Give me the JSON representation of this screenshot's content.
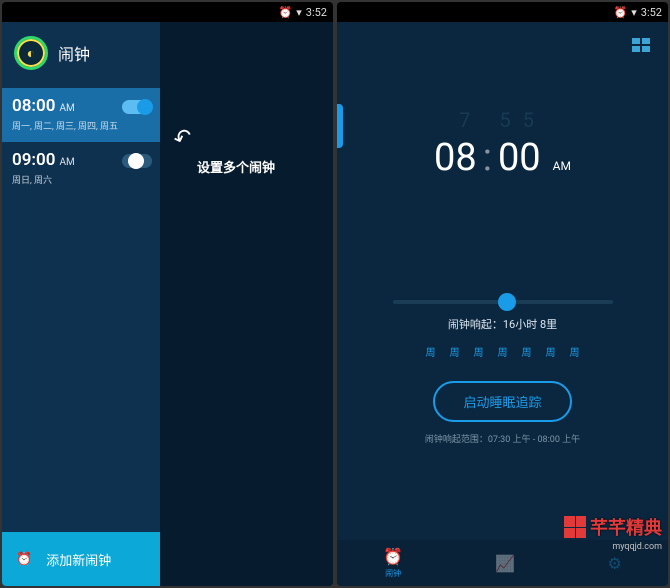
{
  "status": {
    "time": "3:52",
    "alarm_icon": "⏰",
    "wifi_icon": "▾"
  },
  "left": {
    "title": "闹钟",
    "alarms": [
      {
        "time": "08:00",
        "ampm": "AM",
        "days": "周一, 周二, 周三, 周四, 周五",
        "on": true
      },
      {
        "time": "09:00",
        "ampm": "AM",
        "days": "周日, 周六",
        "on": false
      }
    ],
    "tooltip": "设置多个闹钟",
    "footer": {
      "icon": "⏰",
      "label": "添加新闹钟"
    }
  },
  "right": {
    "faint": "7 55",
    "hour": "08",
    "minute": "00",
    "ampm": "AM",
    "ring_label": "闹钟响起：",
    "ring_value": "16小时 8里",
    "days": [
      "周",
      "周",
      "周",
      "周",
      "周",
      "周",
      "周"
    ],
    "action": "启动睡眠追踪",
    "subtext": "闹钟响起范围：07:30 上午 - 08:00 上午",
    "nav": [
      {
        "icon": "⏰",
        "label": "闹钟"
      },
      {
        "icon": "📈",
        "label": ""
      },
      {
        "icon": "⚙",
        "label": ""
      }
    ]
  },
  "watermark": {
    "text": "芊芊精典",
    "url": "myqqjd.com"
  }
}
